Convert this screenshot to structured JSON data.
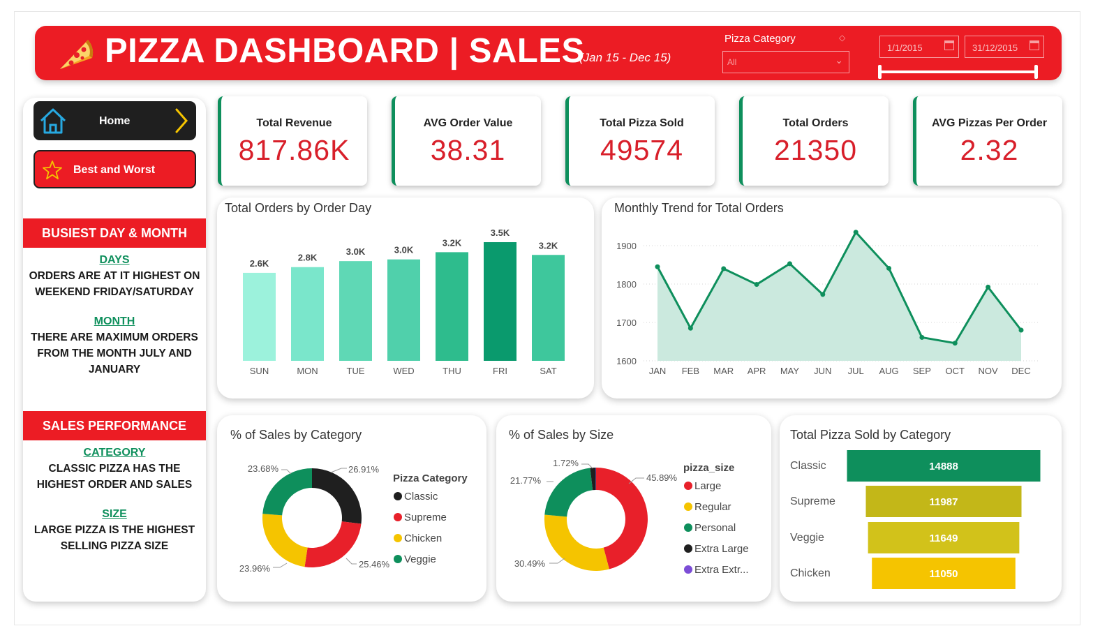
{
  "header": {
    "title": "PIZZA DASHBOARD | SALES",
    "subtitle": "(Jan 15 - Dec 15)",
    "filter_label": "Pizza Category",
    "filter_value": "All",
    "date_start": "1/1/2015",
    "date_end": "31/12/2015",
    "icon": "pizza-slice-icon"
  },
  "nav": {
    "home": "Home",
    "best_worst": "Best and Worst"
  },
  "busiest": {
    "heading": "BUSIEST DAY & MONTH",
    "days_label": "DAYS",
    "days_text_1": "ORDERS ARE AT IT HIGHEST ON",
    "days_text_2": "WEEKEND FRIDAY/SATURDAY",
    "month_label": "MONTH",
    "month_text_1": "THERE ARE MAXIMUM ORDERS",
    "month_text_2": "FROM THE MONTH JULY AND",
    "month_text_3": "JANUARY"
  },
  "performance": {
    "heading": "SALES PERFORMANCE",
    "category_label": "CATEGORY",
    "category_text_1": "CLASSIC PIZZA HAS THE",
    "category_text_2": "HIGHEST ORDER AND SALES",
    "size_label": "SIZE",
    "size_text_1": "LARGE PIZZA IS THE HIGHEST",
    "size_text_2": "SELLING PIZZA SIZE"
  },
  "kpis": [
    {
      "label": "Total Revenue",
      "value": "817.86K"
    },
    {
      "label": "AVG Order Value",
      "value": "38.31"
    },
    {
      "label": "Total Pizza Sold",
      "value": "49574"
    },
    {
      "label": "Total Orders",
      "value": "21350"
    },
    {
      "label": "AVG Pizzas Per Order",
      "value": "2.32"
    }
  ],
  "colors": {
    "brand_red": "#ec1c24",
    "accent_green": "#0e8f5c",
    "kpi_value": "#d81f2a"
  },
  "chart_data": [
    {
      "type": "bar",
      "title": "Total Orders by Order Day",
      "categories": [
        "SUN",
        "MON",
        "TUE",
        "WED",
        "THU",
        "FRI",
        "SAT"
      ],
      "values": [
        2624,
        2794,
        2973,
        3024,
        3239,
        3538,
        3158
      ],
      "labels": [
        "2.6K",
        "2.8K",
        "3.0K",
        "3.0K",
        "3.2K",
        "3.5K",
        "3.2K"
      ],
      "colors": [
        "#9cf2dc",
        "#7ae6cb",
        "#5fd8b5",
        "#50d0ab",
        "#2ebc8d",
        "#0a9a6d",
        "#3ec79c"
      ],
      "ylim": [
        0,
        3538
      ]
    },
    {
      "type": "area",
      "title": "Monthly Trend for Total Orders",
      "x": [
        "JAN",
        "FEB",
        "MAR",
        "APR",
        "MAY",
        "JUN",
        "JUL",
        "AUG",
        "SEP",
        "OCT",
        "NOV",
        "DEC"
      ],
      "values": [
        1845,
        1685,
        1840,
        1799,
        1853,
        1773,
        1935,
        1841,
        1661,
        1646,
        1792,
        1680
      ],
      "y_ticks": [
        "1900",
        "1800",
        "1700",
        "1600"
      ],
      "ylim": [
        1600,
        1900
      ],
      "line_color": "#0e8f5c",
      "fill_color": "#cbe9de"
    },
    {
      "type": "pie",
      "title": "% of Sales by Category",
      "legend_title": "Pizza Category",
      "slices": [
        {
          "name": "Classic",
          "value": 26.91,
          "label": "26.91%",
          "color": "#1f1f1f"
        },
        {
          "name": "Supreme",
          "value": 25.46,
          "label": "25.46%",
          "color": "#e8202a"
        },
        {
          "name": "Chicken",
          "value": 23.96,
          "label": "23.96%",
          "color": "#f5c400"
        },
        {
          "name": "Veggie",
          "value": 23.68,
          "label": "23.68%",
          "color": "#0e8f5c"
        }
      ]
    },
    {
      "type": "pie",
      "title": "% of Sales by Size",
      "legend_title": "pizza_size",
      "slices": [
        {
          "name": "Large",
          "value": 45.89,
          "label": "45.89%",
          "color": "#e8202a"
        },
        {
          "name": "Regular",
          "value": 30.49,
          "label": "30.49%",
          "color": "#f5c400"
        },
        {
          "name": "Personal",
          "value": 21.77,
          "label": "21.77%",
          "color": "#0e8f5c"
        },
        {
          "name": "Extra Large",
          "value": 1.72,
          "label": "1.72%",
          "color": "#1f1f1f"
        },
        {
          "name": "Extra Extr...",
          "value": 0.12,
          "label": "",
          "color": "#7c4dd6"
        }
      ]
    },
    {
      "type": "bar",
      "orientation": "horizontal-funnel",
      "title": "Total Pizza Sold by Category",
      "categories": [
        "Classic",
        "Supreme",
        "Veggie",
        "Chicken"
      ],
      "values": [
        14888,
        11987,
        11649,
        11050
      ],
      "labels": [
        "14888",
        "11987",
        "11649",
        "11050"
      ],
      "colors": [
        "#0e8f5c",
        "#c3b718",
        "#d2c21a",
        "#f5c400"
      ]
    }
  ]
}
